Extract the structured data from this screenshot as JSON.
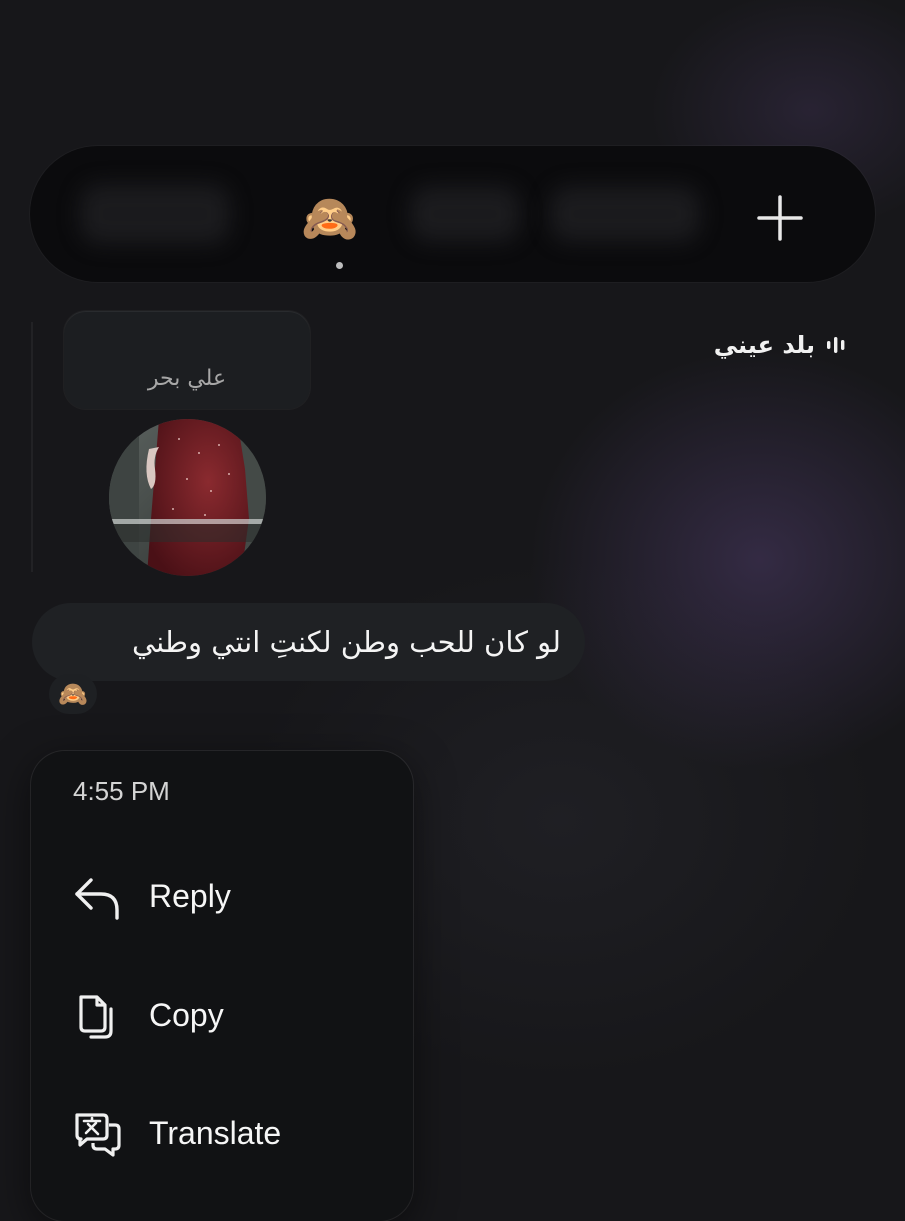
{
  "reaction_bar": {
    "selected_emoji": "🙈",
    "add_label": "+"
  },
  "music_card": {
    "title": "بلد عيني",
    "artist": "علي بحر"
  },
  "message": {
    "text": "لو كان للحب وطن  لكنتِ انتي وطني",
    "reaction": "🙈"
  },
  "menu": {
    "time": "4:55 PM",
    "items": [
      {
        "label": "Reply",
        "icon": "reply-icon"
      },
      {
        "label": "Copy",
        "icon": "copy-icon"
      },
      {
        "label": "Translate",
        "icon": "translate-icon"
      }
    ]
  },
  "colors": {
    "background": "#17171a",
    "bubble": "#1f2124",
    "menu": "#111214",
    "accent_glow": "#5f4882"
  }
}
